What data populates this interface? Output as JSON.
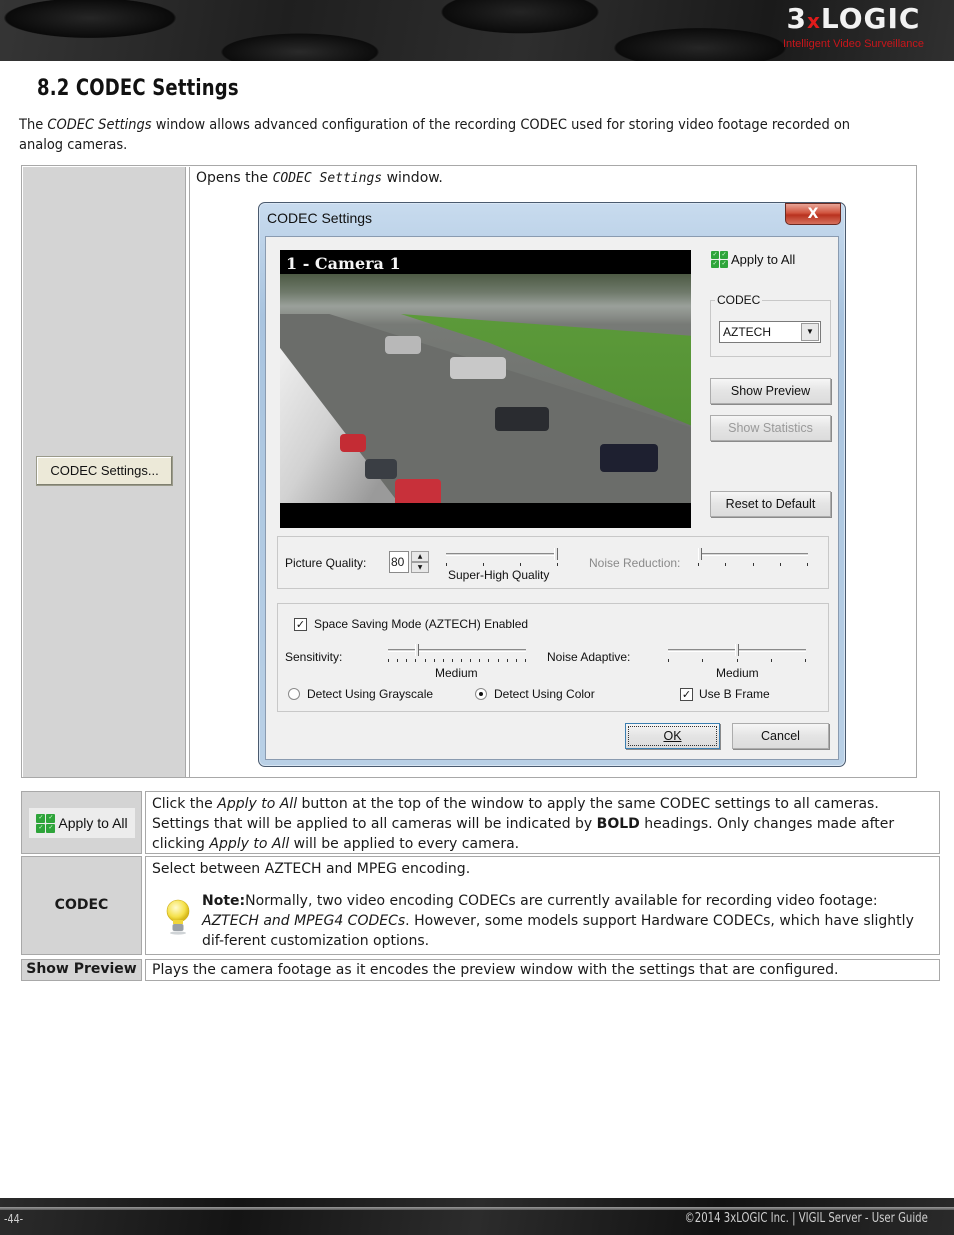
{
  "header": {
    "logo_main_left": "3",
    "logo_x": "x",
    "logo_main_right": "LOGIC",
    "logo_tagline": "Intelligent Video Surveillance",
    "brand_red": "#e01b1b"
  },
  "section": {
    "title": "8.2 CODEC Settings",
    "intro_pre": "The ",
    "intro_em": "CODEC Settings",
    "intro_post": " window allows advanced configuration of the recording CODEC used for storing video footage recorded on analog cameras."
  },
  "top_table": {
    "button_label": "CODEC Settings...",
    "desc_pre": "Opens the ",
    "desc_em": "CODEC Settings",
    "desc_post": " window."
  },
  "dialog": {
    "title": "CODEC Settings",
    "close_glyph": "X",
    "video_label": "1 - Camera 1",
    "apply_all": "Apply to All",
    "codec_group": "CODEC",
    "codec_value": "AZTECH",
    "dropdown_glyph": "▼",
    "show_preview": "Show Preview",
    "show_statistics": "Show Statistics",
    "reset_default": "Reset to Default",
    "picture_quality_label": "Picture Quality:",
    "picture_quality_value": "80",
    "picture_quality_slider_fraction": 1.0,
    "picture_quality_caption": "Super-High Quality",
    "noise_reduction_label": "Noise Reduction:",
    "noise_reduction_fraction": 0.0,
    "space_saving_label": "Space Saving Mode (AZTECH) Enabled",
    "space_saving_checked": true,
    "sensitivity_label": "Sensitivity:",
    "sensitivity_fraction": 0.2,
    "sensitivity_caption": "Medium",
    "noise_adaptive_label": "Noise Adaptive:",
    "noise_adaptive_fraction": 0.5,
    "noise_adaptive_caption": "Medium",
    "radio_grayscale": "Detect Using Grayscale",
    "radio_color": "Detect Using Color",
    "selected_detect": "color",
    "use_b_frame": "Use B Frame",
    "use_b_frame_checked": true,
    "check_glyph": "✓",
    "ok": "OK",
    "cancel": "Cancel"
  },
  "rows": [
    {
      "label": "Apply to All",
      "desc_1": "Click the ",
      "desc_1_em": "Apply to All",
      "desc_2": " button at the top of the window to apply the same CODEC settings to all cameras. Settings that will be applied to all cameras will be indicated by ",
      "desc_2_bold": "BOLD",
      "desc_3": " headings. Only changes made after clicking ",
      "desc_3_em": "Apply to All",
      "desc_4": " will be applied to every camera."
    },
    {
      "label": "CODEC",
      "desc": "Select between AZTECH and MPEG encoding.",
      "note_label": "Note:",
      "note_1": "Normally, two video encoding CODECs are currently available for recording video footage: ",
      "note_em": "AZTECH and MPEG4 CODECs",
      "note_2": ". However, some models support Hardware CODECs, which have slightly dif-ferent customization options."
    },
    {
      "label": "Show Preview",
      "desc": "Plays the camera footage as it encodes the preview window with the settings that are configured."
    }
  ],
  "footer": {
    "page": "-44-",
    "copyright": "©2014 3xLOGIC Inc. | VIGIL Server - User Guide"
  }
}
